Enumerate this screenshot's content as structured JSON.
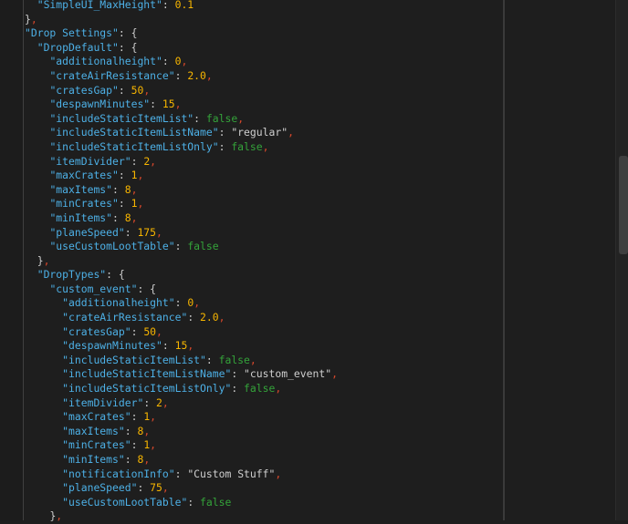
{
  "lines": [
    {
      "indent": "  ",
      "tokens": [
        {
          "t": "key",
          "v": "\"SimpleUI_MaxHeight\""
        },
        {
          "t": "colon",
          "v": ": "
        },
        {
          "t": "num",
          "v": "0.1"
        }
      ]
    },
    {
      "indent": "",
      "tokens": [
        {
          "t": "punc",
          "v": "}"
        },
        {
          "t": "comma",
          "v": ","
        }
      ]
    },
    {
      "indent": "",
      "tokens": [
        {
          "t": "key",
          "v": "\"Drop Settings\""
        },
        {
          "t": "colon",
          "v": ": "
        },
        {
          "t": "punc",
          "v": "{"
        }
      ]
    },
    {
      "indent": "  ",
      "tokens": [
        {
          "t": "key",
          "v": "\"DropDefault\""
        },
        {
          "t": "colon",
          "v": ": "
        },
        {
          "t": "punc",
          "v": "{"
        }
      ]
    },
    {
      "indent": "    ",
      "tokens": [
        {
          "t": "key",
          "v": "\"additionalheight\""
        },
        {
          "t": "colon",
          "v": ": "
        },
        {
          "t": "num",
          "v": "0"
        },
        {
          "t": "comma",
          "v": ","
        }
      ]
    },
    {
      "indent": "    ",
      "tokens": [
        {
          "t": "key",
          "v": "\"crateAirResistance\""
        },
        {
          "t": "colon",
          "v": ": "
        },
        {
          "t": "num",
          "v": "2.0"
        },
        {
          "t": "comma",
          "v": ","
        }
      ]
    },
    {
      "indent": "    ",
      "tokens": [
        {
          "t": "key",
          "v": "\"cratesGap\""
        },
        {
          "t": "colon",
          "v": ": "
        },
        {
          "t": "num",
          "v": "50"
        },
        {
          "t": "comma",
          "v": ","
        }
      ]
    },
    {
      "indent": "    ",
      "tokens": [
        {
          "t": "key",
          "v": "\"despawnMinutes\""
        },
        {
          "t": "colon",
          "v": ": "
        },
        {
          "t": "num",
          "v": "15"
        },
        {
          "t": "comma",
          "v": ","
        }
      ]
    },
    {
      "indent": "    ",
      "tokens": [
        {
          "t": "key",
          "v": "\"includeStaticItemList\""
        },
        {
          "t": "colon",
          "v": ": "
        },
        {
          "t": "bool",
          "v": "false"
        },
        {
          "t": "comma",
          "v": ","
        }
      ]
    },
    {
      "indent": "    ",
      "tokens": [
        {
          "t": "key",
          "v": "\"includeStaticItemListName\""
        },
        {
          "t": "colon",
          "v": ": "
        },
        {
          "t": "str",
          "v": "\"regular\""
        },
        {
          "t": "comma",
          "v": ","
        }
      ]
    },
    {
      "indent": "    ",
      "tokens": [
        {
          "t": "key",
          "v": "\"includeStaticItemListOnly\""
        },
        {
          "t": "colon",
          "v": ": "
        },
        {
          "t": "bool",
          "v": "false"
        },
        {
          "t": "comma",
          "v": ","
        }
      ]
    },
    {
      "indent": "    ",
      "tokens": [
        {
          "t": "key",
          "v": "\"itemDivider\""
        },
        {
          "t": "colon",
          "v": ": "
        },
        {
          "t": "num",
          "v": "2"
        },
        {
          "t": "comma",
          "v": ","
        }
      ]
    },
    {
      "indent": "    ",
      "tokens": [
        {
          "t": "key",
          "v": "\"maxCrates\""
        },
        {
          "t": "colon",
          "v": ": "
        },
        {
          "t": "num",
          "v": "1"
        },
        {
          "t": "comma",
          "v": ","
        }
      ]
    },
    {
      "indent": "    ",
      "tokens": [
        {
          "t": "key",
          "v": "\"maxItems\""
        },
        {
          "t": "colon",
          "v": ": "
        },
        {
          "t": "num",
          "v": "8"
        },
        {
          "t": "comma",
          "v": ","
        }
      ]
    },
    {
      "indent": "    ",
      "tokens": [
        {
          "t": "key",
          "v": "\"minCrates\""
        },
        {
          "t": "colon",
          "v": ": "
        },
        {
          "t": "num",
          "v": "1"
        },
        {
          "t": "comma",
          "v": ","
        }
      ]
    },
    {
      "indent": "    ",
      "tokens": [
        {
          "t": "key",
          "v": "\"minItems\""
        },
        {
          "t": "colon",
          "v": ": "
        },
        {
          "t": "num",
          "v": "8"
        },
        {
          "t": "comma",
          "v": ","
        }
      ]
    },
    {
      "indent": "    ",
      "tokens": [
        {
          "t": "key",
          "v": "\"planeSpeed\""
        },
        {
          "t": "colon",
          "v": ": "
        },
        {
          "t": "num",
          "v": "175"
        },
        {
          "t": "comma",
          "v": ","
        }
      ]
    },
    {
      "indent": "    ",
      "tokens": [
        {
          "t": "key",
          "v": "\"useCustomLootTable\""
        },
        {
          "t": "colon",
          "v": ": "
        },
        {
          "t": "bool",
          "v": "false"
        }
      ]
    },
    {
      "indent": "  ",
      "tokens": [
        {
          "t": "punc",
          "v": "}"
        },
        {
          "t": "comma",
          "v": ","
        }
      ]
    },
    {
      "indent": "  ",
      "tokens": [
        {
          "t": "key",
          "v": "\"DropTypes\""
        },
        {
          "t": "colon",
          "v": ": "
        },
        {
          "t": "punc",
          "v": "{"
        }
      ]
    },
    {
      "indent": "    ",
      "tokens": [
        {
          "t": "key",
          "v": "\"custom_event\""
        },
        {
          "t": "colon",
          "v": ": "
        },
        {
          "t": "punc",
          "v": "{"
        }
      ]
    },
    {
      "indent": "      ",
      "tokens": [
        {
          "t": "key",
          "v": "\"additionalheight\""
        },
        {
          "t": "colon",
          "v": ": "
        },
        {
          "t": "num",
          "v": "0"
        },
        {
          "t": "comma",
          "v": ","
        }
      ]
    },
    {
      "indent": "      ",
      "tokens": [
        {
          "t": "key",
          "v": "\"crateAirResistance\""
        },
        {
          "t": "colon",
          "v": ": "
        },
        {
          "t": "num",
          "v": "2.0"
        },
        {
          "t": "comma",
          "v": ","
        }
      ]
    },
    {
      "indent": "      ",
      "tokens": [
        {
          "t": "key",
          "v": "\"cratesGap\""
        },
        {
          "t": "colon",
          "v": ": "
        },
        {
          "t": "num",
          "v": "50"
        },
        {
          "t": "comma",
          "v": ","
        }
      ]
    },
    {
      "indent": "      ",
      "tokens": [
        {
          "t": "key",
          "v": "\"despawnMinutes\""
        },
        {
          "t": "colon",
          "v": ": "
        },
        {
          "t": "num",
          "v": "15"
        },
        {
          "t": "comma",
          "v": ","
        }
      ]
    },
    {
      "indent": "      ",
      "tokens": [
        {
          "t": "key",
          "v": "\"includeStaticItemList\""
        },
        {
          "t": "colon",
          "v": ": "
        },
        {
          "t": "bool",
          "v": "false"
        },
        {
          "t": "comma",
          "v": ","
        }
      ]
    },
    {
      "indent": "      ",
      "tokens": [
        {
          "t": "key",
          "v": "\"includeStaticItemListName\""
        },
        {
          "t": "colon",
          "v": ": "
        },
        {
          "t": "str",
          "v": "\"custom_event\""
        },
        {
          "t": "comma",
          "v": ","
        }
      ]
    },
    {
      "indent": "      ",
      "tokens": [
        {
          "t": "key",
          "v": "\"includeStaticItemListOnly\""
        },
        {
          "t": "colon",
          "v": ": "
        },
        {
          "t": "bool",
          "v": "false"
        },
        {
          "t": "comma",
          "v": ","
        }
      ]
    },
    {
      "indent": "      ",
      "tokens": [
        {
          "t": "key",
          "v": "\"itemDivider\""
        },
        {
          "t": "colon",
          "v": ": "
        },
        {
          "t": "num",
          "v": "2"
        },
        {
          "t": "comma",
          "v": ","
        }
      ]
    },
    {
      "indent": "      ",
      "tokens": [
        {
          "t": "key",
          "v": "\"maxCrates\""
        },
        {
          "t": "colon",
          "v": ": "
        },
        {
          "t": "num",
          "v": "1"
        },
        {
          "t": "comma",
          "v": ","
        }
      ]
    },
    {
      "indent": "      ",
      "tokens": [
        {
          "t": "key",
          "v": "\"maxItems\""
        },
        {
          "t": "colon",
          "v": ": "
        },
        {
          "t": "num",
          "v": "8"
        },
        {
          "t": "comma",
          "v": ","
        }
      ]
    },
    {
      "indent": "      ",
      "tokens": [
        {
          "t": "key",
          "v": "\"minCrates\""
        },
        {
          "t": "colon",
          "v": ": "
        },
        {
          "t": "num",
          "v": "1"
        },
        {
          "t": "comma",
          "v": ","
        }
      ]
    },
    {
      "indent": "      ",
      "tokens": [
        {
          "t": "key",
          "v": "\"minItems\""
        },
        {
          "t": "colon",
          "v": ": "
        },
        {
          "t": "num",
          "v": "8"
        },
        {
          "t": "comma",
          "v": ","
        }
      ]
    },
    {
      "indent": "      ",
      "tokens": [
        {
          "t": "key",
          "v": "\"notificationInfo\""
        },
        {
          "t": "colon",
          "v": ": "
        },
        {
          "t": "str",
          "v": "\"Custom Stuff\""
        },
        {
          "t": "comma",
          "v": ","
        }
      ]
    },
    {
      "indent": "      ",
      "tokens": [
        {
          "t": "key",
          "v": "\"planeSpeed\""
        },
        {
          "t": "colon",
          "v": ": "
        },
        {
          "t": "num",
          "v": "75"
        },
        {
          "t": "comma",
          "v": ","
        }
      ]
    },
    {
      "indent": "      ",
      "tokens": [
        {
          "t": "key",
          "v": "\"useCustomLootTable\""
        },
        {
          "t": "colon",
          "v": ": "
        },
        {
          "t": "bool",
          "v": "false"
        }
      ]
    },
    {
      "indent": "    ",
      "tokens": [
        {
          "t": "punc",
          "v": "}"
        },
        {
          "t": "comma",
          "v": ","
        }
      ]
    }
  ],
  "colors": {
    "background": "#1e1e1e",
    "key": "#4db0e6",
    "number": "#f7b500",
    "boolean": "#34a33a",
    "comma": "#d9482b"
  }
}
